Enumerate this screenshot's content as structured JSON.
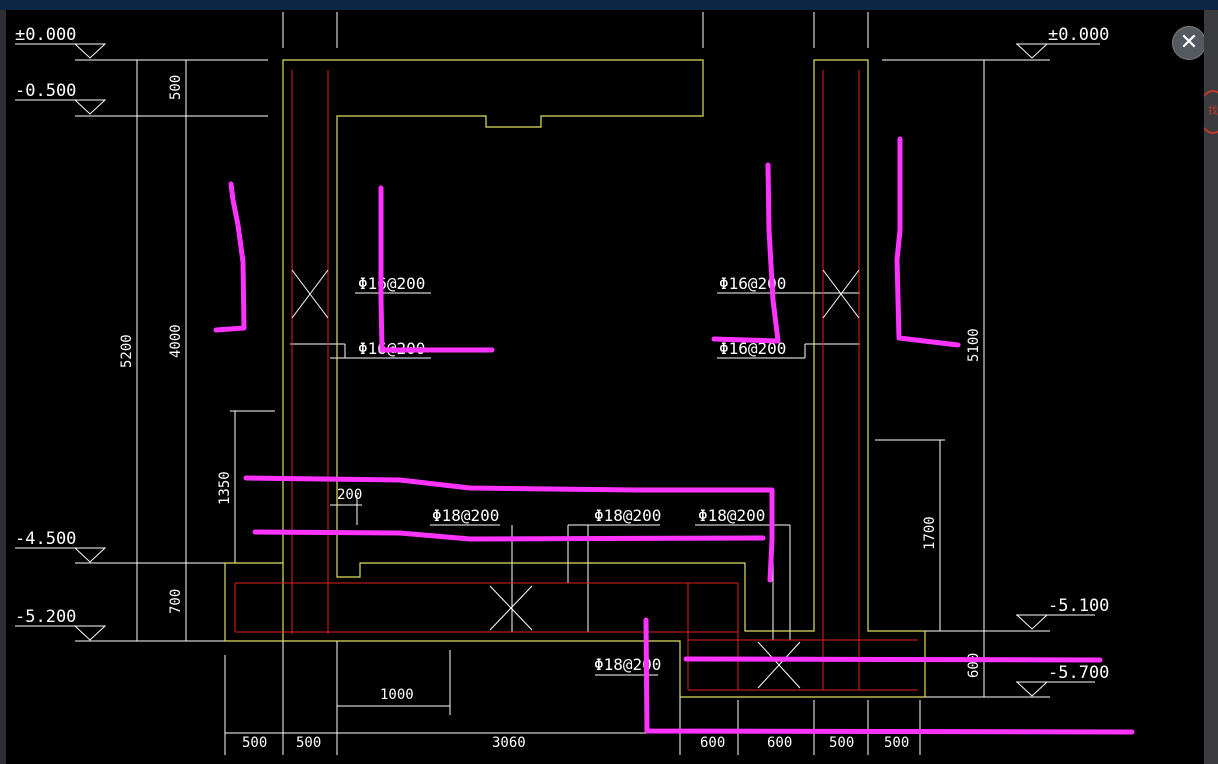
{
  "viewer": {
    "close_icon": "close-icon",
    "close_glyph": "✕"
  },
  "side": {
    "badge_text": "找"
  },
  "elevations": {
    "l_top": "±0.000",
    "l_m05": "-0.500",
    "l_m45": "-4.500",
    "l_m52": "-5.200",
    "r_top": "±0.000",
    "r_m51": "-5.100",
    "r_m57": "-5.700"
  },
  "dims": {
    "d500_top": "500",
    "d5200": "5200",
    "d4000": "4000",
    "d1350": "1350",
    "d700": "700",
    "d200": "200",
    "d1700": "1700",
    "d5100": "5100",
    "d600_right": "600",
    "d1000": "1000",
    "b500a": "500",
    "b500b": "500",
    "b3060": "3060",
    "b600a": "600",
    "b600b": "600",
    "b500c": "500",
    "b500d": "500"
  },
  "rebar": {
    "l_upper": "Φ16@200",
    "l_lower": "Φ16@200",
    "r_upper": "Φ16@200",
    "r_lower": "Φ16@200",
    "slab_1": "Φ18@200",
    "slab_2": "Φ18@200",
    "slab_3": "Φ18@200",
    "pit": "Φ18@200"
  },
  "colors": {
    "background": "#000000",
    "dimension": "#ffffff",
    "outline": "#e0e060",
    "rebar": "#e02020",
    "markup": "#ff33ff"
  }
}
